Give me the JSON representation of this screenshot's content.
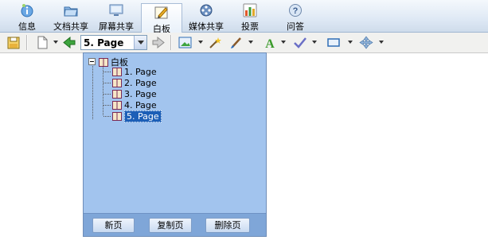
{
  "tabs": [
    {
      "id": "info",
      "label": "信息",
      "icon": "info-icon",
      "active": false
    },
    {
      "id": "doc",
      "label": "文档共享",
      "icon": "folder-icon",
      "active": false
    },
    {
      "id": "screen",
      "label": "屏幕共享",
      "icon": "monitor-icon",
      "active": false
    },
    {
      "id": "wb",
      "label": "白板",
      "icon": "whiteboard-icon",
      "active": true
    },
    {
      "id": "media",
      "label": "媒体共享",
      "icon": "film-reel-icon",
      "active": false
    },
    {
      "id": "vote",
      "label": "投票",
      "icon": "bar-chart-icon",
      "active": false
    },
    {
      "id": "qa",
      "label": "问答",
      "icon": "question-icon",
      "active": false
    }
  ],
  "toolbar": {
    "page_select_value": "5. Page"
  },
  "panel": {
    "root_label": "白板",
    "pages": [
      "1. Page",
      "2. Page",
      "3. Page",
      "4. Page",
      "5. Page"
    ],
    "selected_index": 4,
    "new_page_label": "新页",
    "copy_page_label": "复制页",
    "delete_page_label": "删除页"
  },
  "colors": {
    "panel_bg": "#a2c4ee",
    "selection": "#1c5fb7",
    "toolbar_bg": "#f1f1ef"
  }
}
